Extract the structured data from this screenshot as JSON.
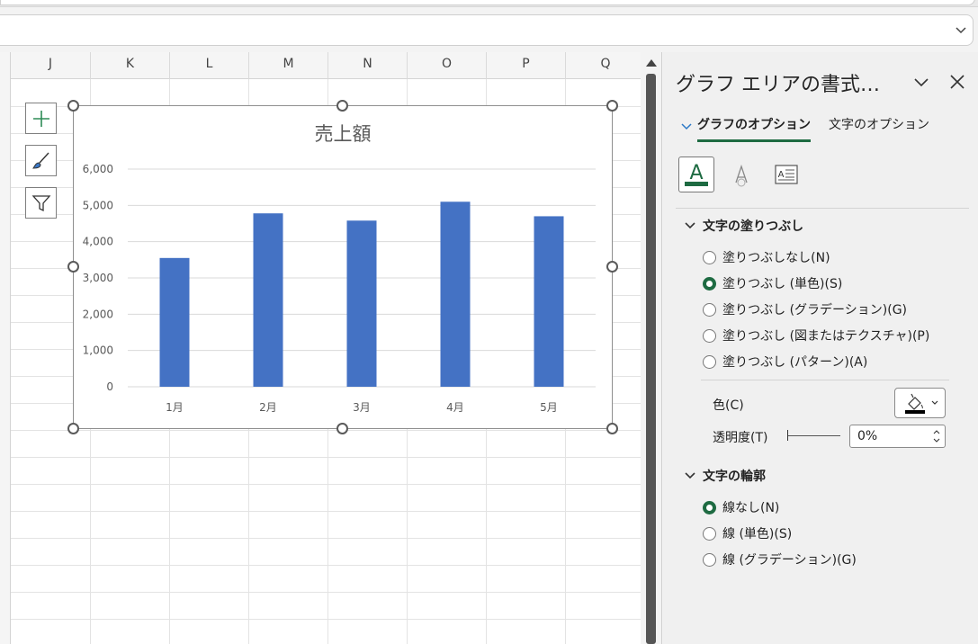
{
  "sheet": {
    "columns": [
      "J",
      "K",
      "L",
      "M",
      "N",
      "O",
      "P",
      "Q"
    ]
  },
  "chart_tools": {
    "elements_icon": "plus-icon",
    "styles_icon": "brush-icon",
    "filters_icon": "filter-icon"
  },
  "chart_data": {
    "type": "bar",
    "title": "売上額",
    "categories": [
      "1月",
      "2月",
      "3月",
      "4月",
      "5月"
    ],
    "values": [
      3550,
      4780,
      4580,
      5100,
      4700
    ],
    "ylim": [
      0,
      6000
    ],
    "yticks": [
      "0",
      "1,000",
      "2,000",
      "3,000",
      "4,000",
      "5,000",
      "6,000"
    ],
    "grid": true,
    "bar_color": "#4472c4"
  },
  "pane": {
    "title": "グラフ エリアの書式…",
    "tabs": [
      {
        "label": "グラフのオプション",
        "active": true
      },
      {
        "label": "文字のオプション",
        "active": false
      }
    ],
    "icons": [
      "text-fill-outline-icon",
      "text-effects-icon",
      "textbox-icon"
    ],
    "text_fill": {
      "header": "文字の塗りつぶし",
      "options": [
        {
          "label": "塗りつぶしなし(N)",
          "selected": false
        },
        {
          "label": "塗りつぶし (単色)(S)",
          "selected": true
        },
        {
          "label": "塗りつぶし (グラデーション)(G)",
          "selected": false
        },
        {
          "label": "塗りつぶし (図またはテクスチャ)(P)",
          "selected": false
        },
        {
          "label": "塗りつぶし (パターン)(A)",
          "selected": false
        }
      ],
      "color_label": "色(C)",
      "transparency_label": "透明度(T)",
      "transparency_value": "0%"
    },
    "text_outline": {
      "header": "文字の輪郭",
      "options": [
        {
          "label": "線なし(N)",
          "selected": true
        },
        {
          "label": "線 (単色)(S)",
          "selected": false
        },
        {
          "label": "線 (グラデーション)(G)",
          "selected": false
        }
      ]
    },
    "accent_color": "#1e6b42"
  }
}
